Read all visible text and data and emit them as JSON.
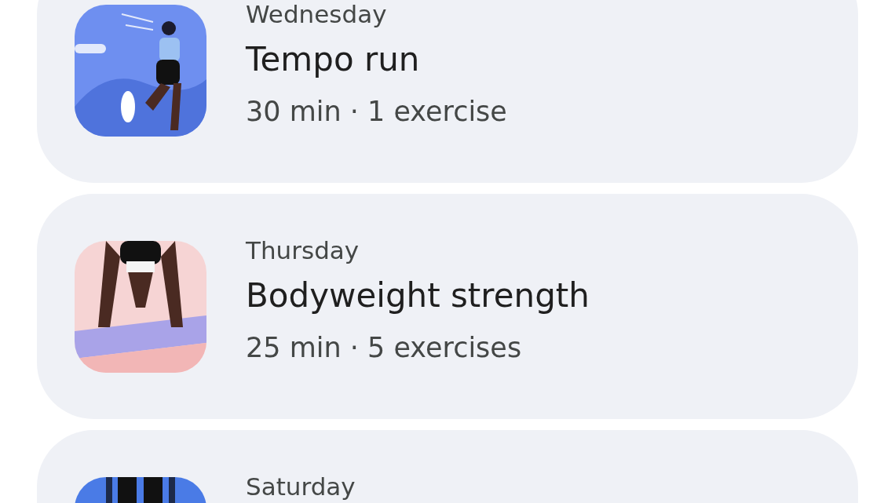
{
  "workouts": [
    {
      "day": "Wednesday",
      "title": "Tempo run",
      "details": "30 min · 1 exercise"
    },
    {
      "day": "Thursday",
      "title": "Bodyweight strength",
      "details": "25 min · 5 exercises"
    },
    {
      "day": "Saturday"
    }
  ]
}
